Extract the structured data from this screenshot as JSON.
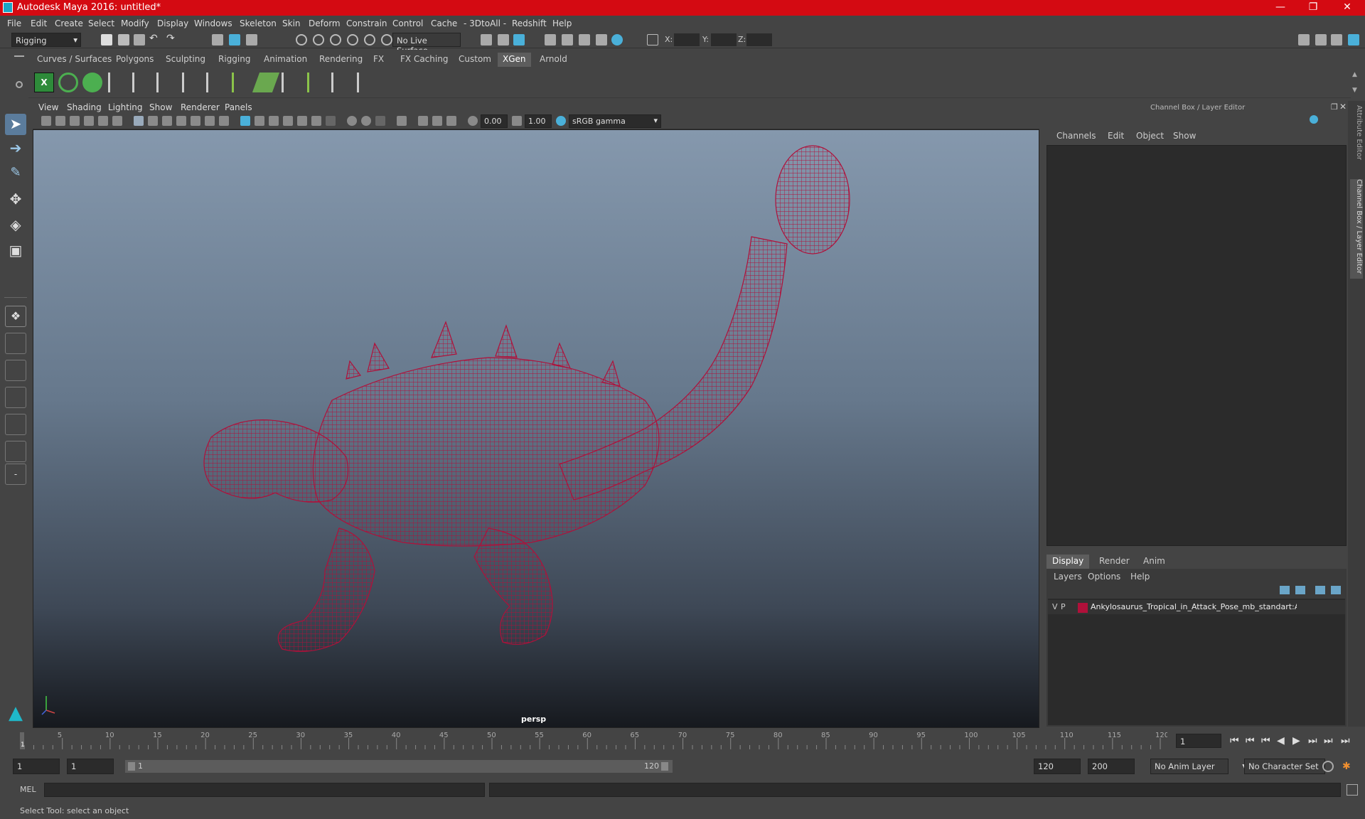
{
  "window": {
    "title": "Autodesk Maya 2016: untitled*"
  },
  "menu": [
    "File",
    "Edit",
    "Create",
    "Select",
    "Modify",
    "Display",
    "Windows",
    "Skeleton",
    "Skin",
    "Deform",
    "Constrain",
    "Control",
    "Cache",
    "- 3DtoAll -",
    "Redshift",
    "Help"
  ],
  "status_line": {
    "mode": "Rigging",
    "live_surface": "No Live Surface",
    "x_label": "X:",
    "y_label": "Y:",
    "z_label": "Z:"
  },
  "shelf_tabs": [
    "Curves / Surfaces",
    "Polygons",
    "Sculpting",
    "Rigging",
    "Animation",
    "Rendering",
    "FX",
    "FX Caching",
    "Custom",
    "XGen",
    "Arnold"
  ],
  "shelf_active": "XGen",
  "viewport": {
    "menu": [
      "View",
      "Shading",
      "Lighting",
      "Show",
      "Renderer",
      "Panels"
    ],
    "exposure": "0.00",
    "gamma": "1.00",
    "color_space": "sRGB gamma",
    "camera_label": "persp",
    "mesh_color": "#b0103a"
  },
  "channel_box": {
    "title": "Channel Box / Layer Editor",
    "menu": [
      "Channels",
      "Edit",
      "Object",
      "Show"
    ],
    "layer_tabs": [
      "Display",
      "Render",
      "Anim"
    ],
    "layer_active": "Display",
    "layer_menu": [
      "Layers",
      "Options",
      "Help"
    ],
    "layer": {
      "v": "V",
      "p": "P",
      "color": "#b0103a",
      "name": "Ankylosaurus_Tropical_in_Attack_Pose_mb_standart:Anky"
    }
  },
  "side_tabs": [
    "Attribute Editor",
    "Channel Box / Layer Editor"
  ],
  "timeline": {
    "ticks": [
      "5",
      "10",
      "15",
      "20",
      "25",
      "30",
      "35",
      "40",
      "45",
      "50",
      "55",
      "60",
      "65",
      "70",
      "75",
      "80",
      "85",
      "90",
      "95",
      "100",
      "105",
      "110",
      "115",
      "120"
    ],
    "current_marker": "1",
    "current_frame": "1"
  },
  "range": {
    "start": "1",
    "playback_start": "1",
    "slider_start": "1",
    "slider_end": "120",
    "playback_end": "120",
    "end": "200",
    "anim_layer": "No Anim Layer",
    "character_set": "No Character Set"
  },
  "command_line": {
    "lang": "MEL"
  },
  "help_line": {
    "text": "Select Tool: select an object"
  }
}
